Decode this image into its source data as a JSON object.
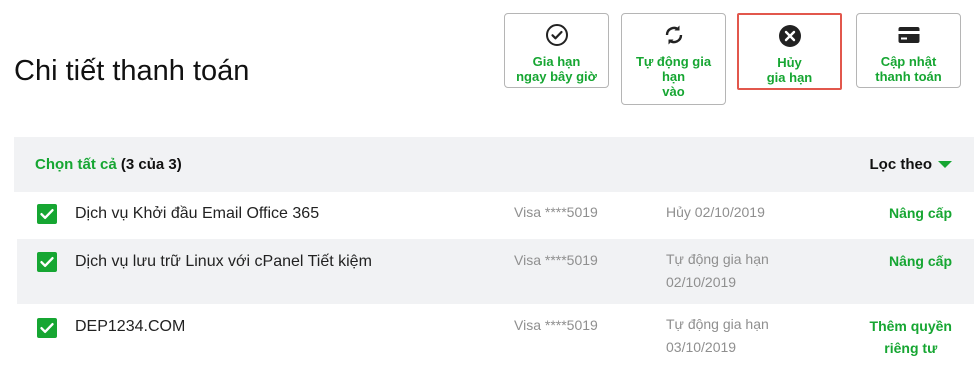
{
  "page": {
    "title": "Chi tiết thanh toán"
  },
  "actions": [
    {
      "label": "Gia hạn\nngay bây giờ",
      "icon": "check-circle-icon"
    },
    {
      "label": "Tự động gia\nhạn\nvào",
      "icon": "refresh-icon"
    },
    {
      "label": "Hủy\ngia hạn",
      "icon": "cancel-circle-icon"
    },
    {
      "label": "Cập nhật\nthanh toán",
      "icon": "credit-card-icon"
    }
  ],
  "table": {
    "select_all_label": "Chọn tất cả",
    "select_count": "(3 của 3)",
    "filter_label": "Lọc theo"
  },
  "rows": [
    {
      "name": "Dịch vụ Khởi đầu Email Office 365",
      "card": "Visa ****5019",
      "status": "Hủy 02/10/2019",
      "action": "Nâng cấp",
      "checked": true
    },
    {
      "name": "Dịch vụ lưu trữ Linux với cPanel Tiết kiệm",
      "card": "Visa ****5019",
      "status": "Tự động gia hạn\n02/10/2019",
      "action": "Nâng cấp",
      "checked": true
    },
    {
      "name": "DEP1234.COM",
      "card": "Visa ****5019",
      "status": "Tự động gia hạn\n03/10/2019",
      "action": "Thêm quyền\nriêng tư",
      "checked": true
    }
  ],
  "colors": {
    "accent": "#16a632",
    "highlight": "#e2574c",
    "row_alt": "#f1f2f4"
  }
}
